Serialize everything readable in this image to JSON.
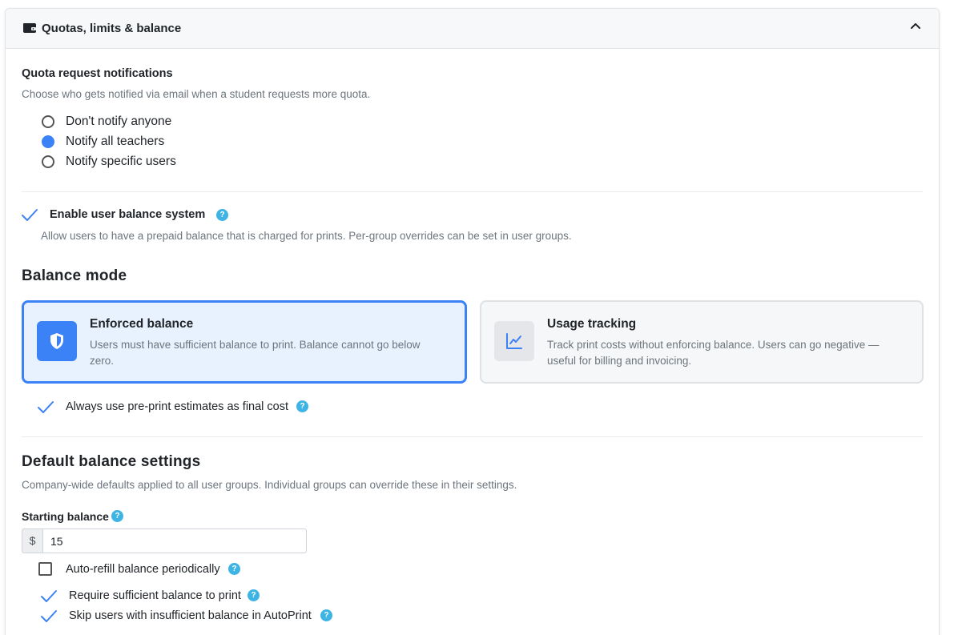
{
  "header": {
    "icon": "wallet-icon",
    "title": "Quotas, limits & balance",
    "collapse_icon": "chevron-up-icon"
  },
  "quota_notifications": {
    "title": "Quota request notifications",
    "description": "Choose who gets notified via email when a student requests more quota.",
    "options": [
      {
        "label": "Don't notify anyone",
        "selected": false
      },
      {
        "label": "Notify all teachers",
        "selected": true
      },
      {
        "label": "Notify specific users",
        "selected": false
      }
    ]
  },
  "balance_system": {
    "label": "Enable user balance system",
    "checked": true,
    "help": "?",
    "description": "Allow users to have a prepaid balance that is charged for prints. Per-group overrides can be set in user groups."
  },
  "balance_mode": {
    "title": "Balance mode",
    "cards": [
      {
        "title": "Enforced balance",
        "icon": "shield-icon",
        "selected": true,
        "description_line1": "Users must have sufficient balance to print. Balance cannot go below",
        "description_line2": "zero."
      },
      {
        "title": "Usage tracking",
        "icon": "line-chart-icon",
        "selected": false,
        "description_line1": "Track print costs without enforcing balance. Users can go negative —",
        "description_line2": "useful for billing and invoicing."
      }
    ],
    "estimates_option": {
      "label": "Always use pre-print estimates as final cost",
      "checked": true,
      "help": "?"
    }
  },
  "default_balance": {
    "title": "Default balance settings",
    "description": "Company-wide defaults applied to all user groups. Individual groups can override these in their settings.",
    "starting_balance": {
      "label": "Starting balance",
      "help": "?",
      "currency": "$",
      "value": "15"
    },
    "options": [
      {
        "label": "Auto-refill balance periodically",
        "checked": false,
        "help": "?"
      },
      {
        "label": "Require sufficient balance to print",
        "checked": true,
        "help": "?"
      },
      {
        "label": "Skip users with insufficient balance in AutoPrint",
        "checked": true,
        "help": "?"
      }
    ]
  },
  "colors": {
    "accent": "#3b82f6",
    "help_badge": "#3db4e3",
    "selected_card_bg": "#e8f2fe",
    "muted_text": "#6c757d"
  }
}
